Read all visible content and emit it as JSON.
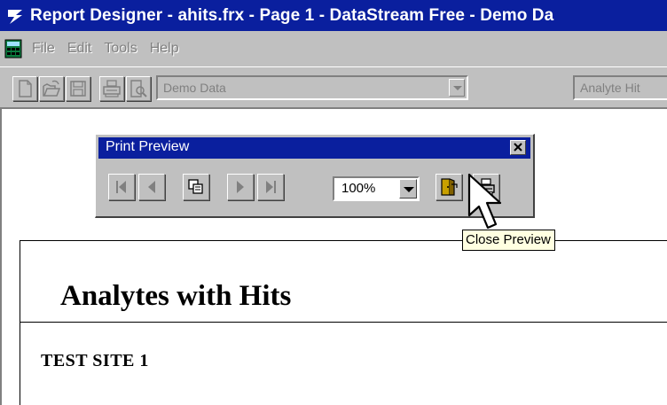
{
  "window": {
    "title": "Report Designer - ahits.frx - Page 1 - DataStream Free - Demo Da"
  },
  "menu": {
    "items": [
      "File",
      "Edit",
      "Tools",
      "Help"
    ]
  },
  "toolbar": {
    "data_combo_value": "Demo Data",
    "report_combo_value": "Analyte Hit"
  },
  "print_preview": {
    "title": "Print Preview",
    "zoom_value": "100%",
    "close_preview_tooltip": "Close Preview"
  },
  "report": {
    "title": "Analytes with Hits",
    "site": "TEST SITE 1"
  },
  "colors": {
    "titlebar": "#0a1f9e",
    "face": "#c0c0c0",
    "tooltip_bg": "#ffffe1"
  },
  "icons": [
    "app-icon",
    "calculator-icon",
    "new-icon",
    "open-icon",
    "save-icon",
    "print-icon",
    "preview-icon",
    "first-page-icon",
    "prev-page-icon",
    "multi-page-icon",
    "next-page-icon",
    "last-page-icon",
    "close-preview-icon",
    "print-icon",
    "close-icon",
    "cursor-icon"
  ]
}
